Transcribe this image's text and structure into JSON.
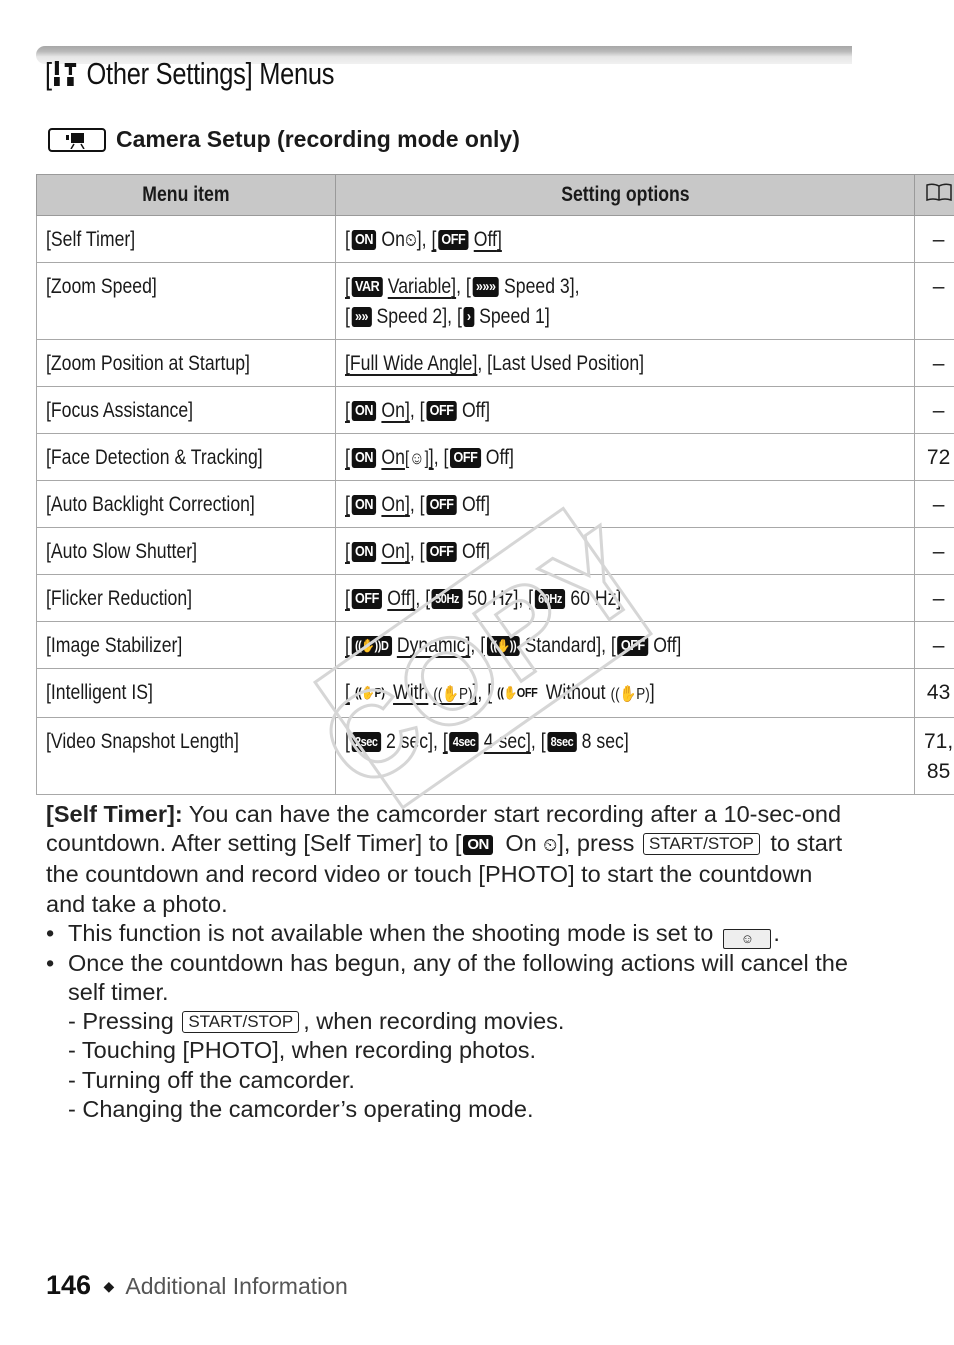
{
  "page": {
    "title_prefix": "[",
    "title_text": " Other Settings] Menus",
    "title_icon": "tools-icon",
    "subtitle": "Camera Setup (recording mode only)",
    "subtitle_icon": "movie-camera-icon"
  },
  "table": {
    "headers": [
      "Menu item",
      "Setting options",
      "book-reference-icon"
    ],
    "reference_header_glyph": "📖",
    "rows": [
      {
        "item": "[Self Timer]",
        "options": [
          {
            "badge": "ON",
            "label": "On",
            "glyph": "self-timer",
            "default": false
          },
          {
            "badge": "OFF",
            "label": "Off",
            "default": true
          }
        ],
        "ref": "–"
      },
      {
        "item": "[Zoom Speed]",
        "options": [
          {
            "badge": "VAR",
            "label": "Variable",
            "default": true
          },
          {
            "badge": "»»»",
            "label": "Speed 3",
            "default": false
          },
          {
            "badge": "»»",
            "label": "Speed 2",
            "default": false
          },
          {
            "badge": "›",
            "label": "Speed 1",
            "default": false
          }
        ],
        "ref": "–"
      },
      {
        "item": "[Zoom Position at Startup]",
        "options": [
          {
            "label": "Full Wide Angle",
            "default": true
          },
          {
            "label": "Last Used Position",
            "default": false
          }
        ],
        "ref": "–"
      },
      {
        "item": "[Focus Assistance]",
        "options": [
          {
            "badge": "ON",
            "label": "On",
            "default": true
          },
          {
            "badge": "OFF",
            "label": "Off",
            "default": false
          }
        ],
        "ref": "–"
      },
      {
        "item": "[Face Detection & Tracking]",
        "options": [
          {
            "badge": "ON",
            "label": "On",
            "glyph": "face-detection",
            "default": true
          },
          {
            "badge": "OFF",
            "label": "Off",
            "default": false
          }
        ],
        "ref": "72"
      },
      {
        "item": "[Auto Backlight Correction]",
        "options": [
          {
            "badge": "ON",
            "label": "On",
            "default": true
          },
          {
            "badge": "OFF",
            "label": "Off",
            "default": false
          }
        ],
        "ref": "–"
      },
      {
        "item": "[Auto Slow Shutter]",
        "options": [
          {
            "badge": "ON",
            "label": "On",
            "default": true
          },
          {
            "badge": "OFF",
            "label": "Off",
            "default": false
          }
        ],
        "ref": "–"
      },
      {
        "item": "[Flicker Reduction]",
        "options": [
          {
            "badge": "OFF",
            "label": "Off",
            "default": true
          },
          {
            "badge": "50Hz",
            "label": "50 Hz",
            "default": false
          },
          {
            "badge": "60Hz",
            "label": "60 Hz",
            "default": false
          }
        ],
        "ref": "–"
      },
      {
        "item": "[Image Stabilizer]",
        "options": [
          {
            "badge": "((✋))D",
            "label": "Dynamic",
            "default": true
          },
          {
            "badge": "((✋))",
            "label": "Standard",
            "default": false
          },
          {
            "badge": "OFF",
            "label": "Off",
            "default": false
          }
        ],
        "ref": "–"
      },
      {
        "item": "[Intelligent IS]",
        "options": [
          {
            "icon": "((✋P)",
            "label": "With",
            "glyph_text": "((✋P)",
            "default": true
          },
          {
            "icon": "((✋OFF",
            "label": "Without",
            "glyph_text": "((✋P)",
            "default": false
          }
        ],
        "ref": "43"
      },
      {
        "item": "[Video Snapshot Length]",
        "options": [
          {
            "badge": "2sec",
            "label": "2 sec",
            "default": false
          },
          {
            "badge": "4sec",
            "label": "4 sec",
            "default": true
          },
          {
            "badge": "8sec",
            "label": "8 sec",
            "default": false
          }
        ],
        "ref": "71,\n85"
      }
    ]
  },
  "watermark": "COPY",
  "body": {
    "lead": "[Self Timer]:",
    "para1_a": " You can have the camcorder start recording after a 10-sec-ond countdown. After setting [Self Timer] to [",
    "para1_badge": "ON",
    "para1_b": " On ",
    "para1_c": "], press ",
    "key_start_stop": "START/STOP",
    "para1_d": " to start the countdown and record video or touch [PHOTO] to start the countdown and take a photo.",
    "bullet1": "This function is not available when the shooting mode is set to",
    "bullet1_end": ".",
    "bullet2": "Once the countdown has begun, any of the following actions will cancel the self timer.",
    "sub1_a": "- Pressing ",
    "sub1_b": ", when recording movies.",
    "sub2": "- Touching [PHOTO], when recording photos.",
    "sub3": "- Turning off the camcorder.",
    "sub4": "- Changing the camcorder’s operating mode."
  },
  "footer": {
    "page_number": "146",
    "separator": "◆",
    "section": "Additional Information"
  }
}
